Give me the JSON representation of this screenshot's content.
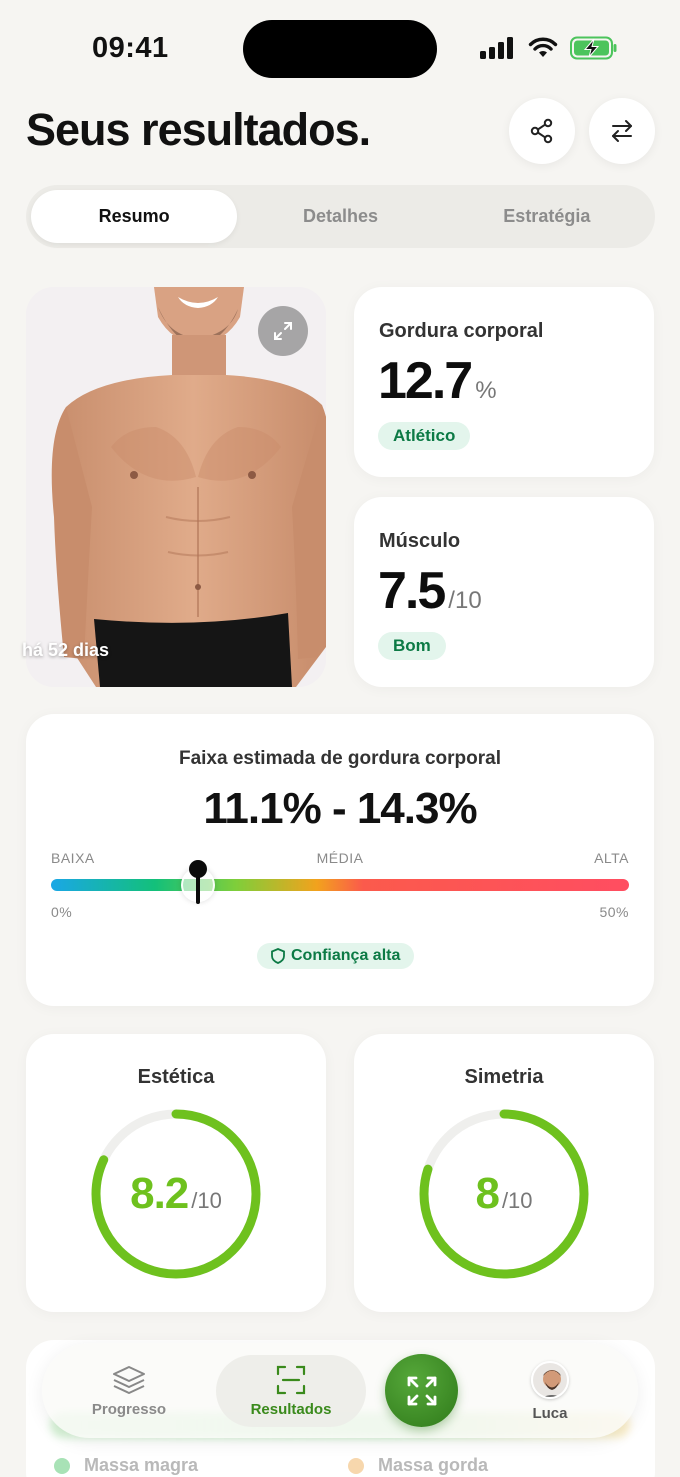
{
  "status_bar": {
    "time": "09:41"
  },
  "header": {
    "title": "Seus resultados."
  },
  "tabs": [
    {
      "label": "Resumo",
      "active": true
    },
    {
      "label": "Detalhes",
      "active": false
    },
    {
      "label": "Estratégia",
      "active": false
    }
  ],
  "photo": {
    "caption": "há 52 dias"
  },
  "body_fat": {
    "label": "Gordura corporal",
    "value": "12.7",
    "unit": "%",
    "badge": "Atlético"
  },
  "muscle": {
    "label": "Músculo",
    "value": "7.5",
    "unit": "/10",
    "badge": "Bom"
  },
  "range": {
    "title": "Faixa estimada de gordura corporal",
    "value": "11.1% - 14.3%",
    "low_label": "BAIXA",
    "mid_label": "MÉDIA",
    "high_label": "ALTA",
    "min_label": "0%",
    "max_label": "50%",
    "marker_fraction": 0.254,
    "confidence": "Confiança alta"
  },
  "aesthetics": {
    "label": "Estética",
    "value": "8.2",
    "unit": "/10",
    "fraction": 0.82
  },
  "symmetry": {
    "label": "Simetria",
    "value": "8",
    "unit": "/10",
    "fraction": 0.8
  },
  "legend": {
    "lean_mass": "Massa magra",
    "fat_mass": "Massa gorda"
  },
  "nav": {
    "progress": "Progresso",
    "results": "Resultados",
    "profile": "Luca"
  },
  "colors": {
    "accent_green": "#6ec11e",
    "badge_bg": "#e3f5ec",
    "badge_text": "#0c7a45",
    "scan_button": "#3a8a1c"
  }
}
